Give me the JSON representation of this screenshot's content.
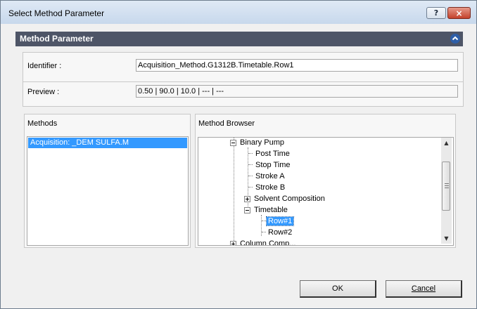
{
  "window": {
    "title": "Select Method Parameter",
    "help_label": "?",
    "close_label": "×"
  },
  "header": {
    "title": "Method Parameter",
    "collapse_icon": "chevron-up-icon"
  },
  "fields": {
    "identifier_label": "Identifier :",
    "identifier_value": "Acquisition_Method.G1312B.Timetable.Row1",
    "preview_label": "Preview :",
    "preview_value": "0.50 | 90.0 | 10.0 | --- | ---"
  },
  "methods_panel": {
    "title": "Methods",
    "items": [
      {
        "label": "Acquisition: _DEM SULFA.M",
        "selected": true
      }
    ]
  },
  "browser_panel": {
    "title": "Method Browser",
    "tree": [
      {
        "label": "Binary Pump",
        "expander": "minus"
      },
      {
        "label": "Post Time"
      },
      {
        "label": "Stop Time"
      },
      {
        "label": "Stroke A"
      },
      {
        "label": "Stroke B"
      },
      {
        "label": "Solvent Composition",
        "expander": "plus"
      },
      {
        "label": "Timetable",
        "expander": "minus"
      },
      {
        "label": "Row#1",
        "selected": true
      },
      {
        "label": "Row#2"
      },
      {
        "label": "Column Comp..."
      }
    ]
  },
  "buttons": {
    "ok_label": "OK",
    "cancel_label": "Cancel"
  }
}
